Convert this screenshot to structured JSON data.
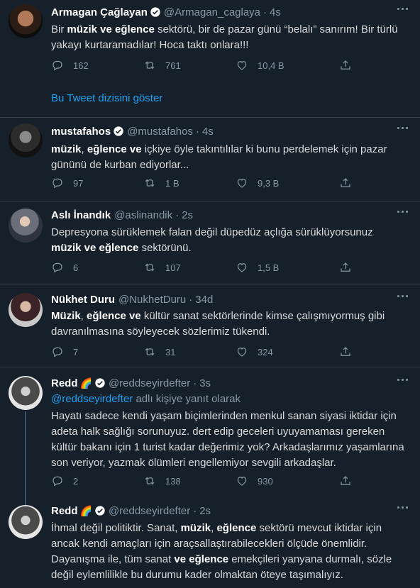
{
  "tweets": [
    {
      "name": "Armagan Çağlayan",
      "handle": "@Armagan_caglaya",
      "time": "4s",
      "text_parts": [
        {
          "t": "Bir ",
          "b": false
        },
        {
          "t": "müzik ve eğlence",
          "b": true
        },
        {
          "t": " sektörü, bir de pazar günü “belalı” sanırım! Bir türlü yakayı kurtaramadılar! Hoca taktı onlara!!!",
          "b": false
        }
      ],
      "replies": "162",
      "retweets": "761",
      "likes": "10,4 B",
      "show_thread": "Bu Tweet dizisini göster"
    },
    {
      "name": "mustafahos",
      "handle": "@mustafahos",
      "time": "4s",
      "text_parts": [
        {
          "t": "müzik",
          "b": true
        },
        {
          "t": ", ",
          "b": false
        },
        {
          "t": "eğlence ve",
          "b": true
        },
        {
          "t": " içkiye öyle takıntılılar ki bunu perdelemek için pazar gününü de kurban ediyorlar...",
          "b": false
        }
      ],
      "replies": "97",
      "retweets": "1 B",
      "likes": "9,3 B"
    },
    {
      "name": "Aslı İnandık",
      "handle": "@aslinandik",
      "time": "2s",
      "text_parts": [
        {
          "t": "Depresyona sürüklemek falan değil düpedüz açlığa sürüklüyorsunuz ",
          "b": false
        },
        {
          "t": "müzik ve eğlence",
          "b": true
        },
        {
          "t": " sektörünü.",
          "b": false
        }
      ],
      "replies": "6",
      "retweets": "107",
      "likes": "1,5 B"
    },
    {
      "name": "Nükhet Duru",
      "handle": "@NukhetDuru",
      "time": "34d",
      "text_parts": [
        {
          "t": "Müzik",
          "b": true
        },
        {
          "t": ", ",
          "b": false
        },
        {
          "t": "eğlence ve",
          "b": true
        },
        {
          "t": " kültür sanat sektörlerinde kimse çalışmıyormuş gibi davranılmasına söyleyecek sözlerimiz tükendi.",
          "b": false
        }
      ],
      "replies": "7",
      "retweets": "31",
      "likes": "324"
    },
    {
      "name": "Redd",
      "emoji": "🌈",
      "handle": "@reddseyirdefter",
      "time": "3s",
      "reply_mention": "@reddseyirdefter",
      "reply_suffix": " adlı kişiye yanıt olarak",
      "text_parts": [
        {
          "t": "Hayatı sadece kendi yaşam biçimlerinden menkul sanan siyasi iktidar için adeta halk sağlığı sorunuyuz. dert edip geceleri uyuyamaması gereken kültür bakanı için 1 turist kadar değerimiz yok? Arkadaşlarımız yaşamlarına son veriyor, yazmak ölümleri engellemiyor sevgili arkadaşlar.",
          "b": false
        }
      ],
      "replies": "2",
      "retweets": "138",
      "likes": "930"
    },
    {
      "name": "Redd",
      "emoji": "🌈",
      "handle": "@reddseyirdefter",
      "time": "2s",
      "text_parts": [
        {
          "t": "İhmal değil politiktir. Sanat, ",
          "b": false
        },
        {
          "t": "müzik",
          "b": true
        },
        {
          "t": ", ",
          "b": false
        },
        {
          "t": "eğlence",
          "b": true
        },
        {
          "t": " sektörü mevcut iktidar için ancak kendi amaçları için araçsallaştırabilecekleri ölçüde önemlidir. Dayanışma ile, tüm sanat ",
          "b": false
        },
        {
          "t": "ve eğlence",
          "b": true
        },
        {
          "t": " emekçileri yanyana durmalı, sözle değil eylemlilikle bu durumu kader olmaktan öteye taşımalıyız.",
          "b": false
        }
      ]
    }
  ],
  "colors": {
    "background": "#15202b",
    "accent": "#1da1f2",
    "muted": "#8899a6",
    "divider": "#38444d"
  }
}
